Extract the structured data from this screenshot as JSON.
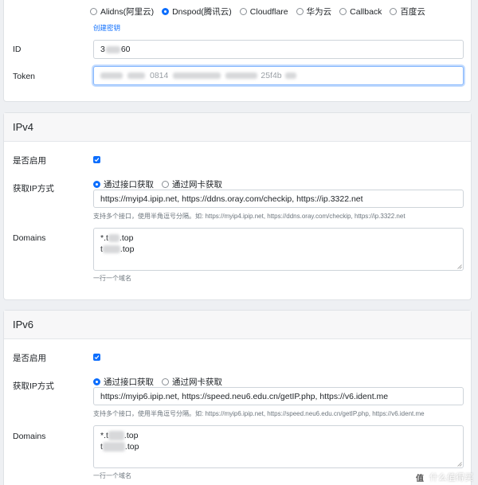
{
  "dns_section": {
    "providers": [
      {
        "label": "Alidns(阿里云)",
        "selected": false
      },
      {
        "label": "Dnspod(腾讯云)",
        "selected": true
      },
      {
        "label": "Cloudflare",
        "selected": false
      },
      {
        "label": "华为云",
        "selected": false
      },
      {
        "label": "Callback",
        "selected": false
      },
      {
        "label": "百度云",
        "selected": false
      }
    ],
    "create_key_link": "创建密钥",
    "id_label": "ID",
    "id_value_prefix": "3",
    "id_value_suffix": "60",
    "token_label": "Token",
    "token_value_fragment_1": "",
    "token_value_fragment_2": "0814",
    "token_value_fragment_3": "25f4b"
  },
  "ipv4": {
    "title": "IPv4",
    "enable_label": "是否启用",
    "enabled": true,
    "get_ip_label": "获取IP方式",
    "methods": [
      {
        "label": "通过接口获取",
        "selected": true
      },
      {
        "label": "通过网卡获取",
        "selected": false
      }
    ],
    "url_value": "https://myip4.ipip.net, https://ddns.oray.com/checkip, https://ip.3322.net",
    "url_help": "支持多个接口，使用半角逗号分隔。如: https://myip4.ipip.net, https://ddns.oray.com/checkip, https://ip.3322.net",
    "domains_label": "Domains",
    "domain_lines": [
      {
        "prefix": "*.t",
        "suffix": ".top"
      },
      {
        "prefix": "t",
        "suffix": ".top"
      }
    ],
    "domains_help": "一行一个域名"
  },
  "ipv6": {
    "title": "IPv6",
    "enable_label": "是否启用",
    "enabled": true,
    "get_ip_label": "获取IP方式",
    "methods": [
      {
        "label": "通过接口获取",
        "selected": true
      },
      {
        "label": "通过网卡获取",
        "selected": false
      }
    ],
    "url_value": "https://myip6.ipip.net, https://speed.neu6.edu.cn/getIP.php, https://v6.ident.me",
    "url_help": "支持多个接口，使用半角逗号分隔。如: https://myip6.ipip.net, https://speed.neu6.edu.cn/getIP.php, https://v6.ident.me",
    "domains_label": "Domains",
    "domain_lines": [
      {
        "prefix": "*.t",
        "suffix": ".top"
      },
      {
        "prefix": "t",
        "suffix": ".top"
      }
    ],
    "domains_help": "一行一个域名"
  },
  "watermark": {
    "logo_glyph": "值",
    "text": "什么值得买"
  },
  "colors": {
    "accent": "#0d6efd",
    "border": "#ced4da",
    "background": "#eef0f3",
    "card": "#ffffff"
  }
}
